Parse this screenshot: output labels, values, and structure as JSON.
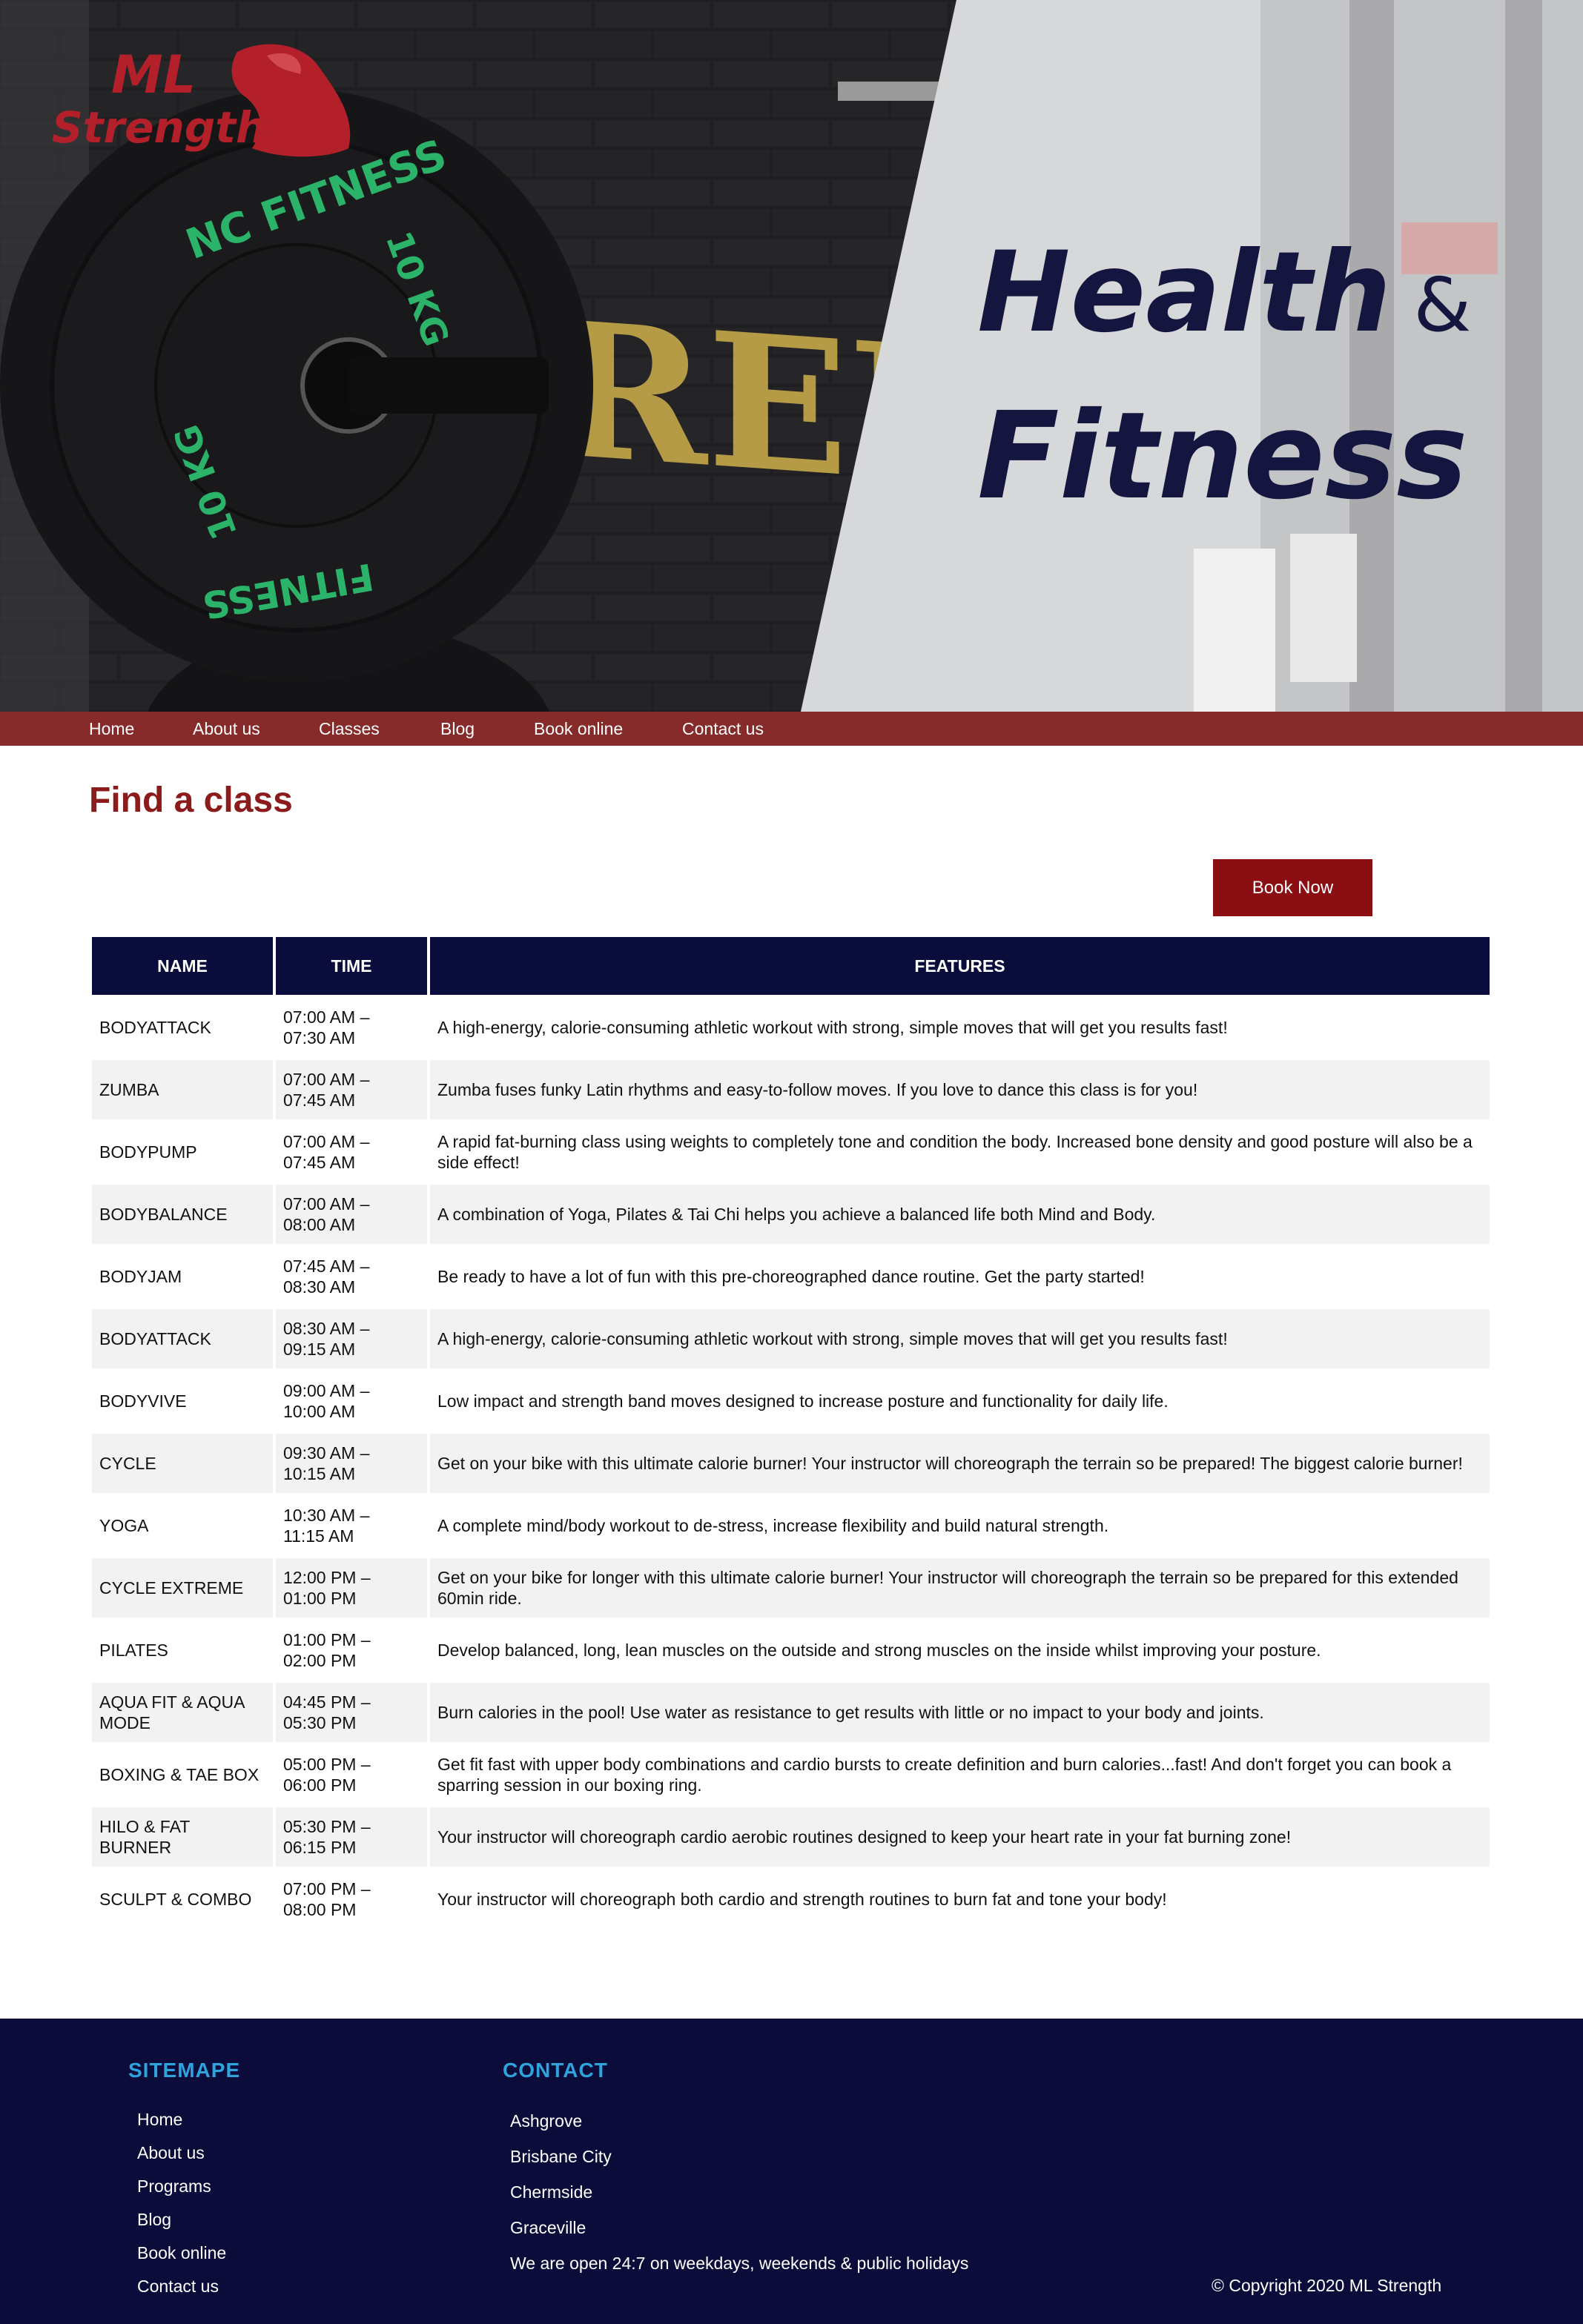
{
  "brand": {
    "logo_line1": "ML",
    "logo_line2": "Strength",
    "color_primary": "#862a2a",
    "color_dark": "#0b0c3a",
    "color_accent": "#2ea3dc"
  },
  "hero": {
    "title_word1": "Health",
    "title_amp": "&",
    "title_word2": "Fitness"
  },
  "nav": {
    "items": [
      "Home",
      "About us",
      "Classes",
      "Blog",
      "Book online",
      "Contact us"
    ]
  },
  "main": {
    "title": "Find a class",
    "book_button": "Book Now"
  },
  "table": {
    "headers": [
      "NAME",
      "TIME",
      "FEATURES"
    ],
    "rows": [
      [
        "BODYATTACK",
        "07:00 AM –\n07:30 AM",
        "A high-energy, calorie-consuming athletic workout with strong, simple moves that will get you results fast!"
      ],
      [
        "ZUMBA",
        "07:00 AM –\n07:45 AM",
        "Zumba fuses funky Latin rhythms and easy-to-follow moves. If you love to dance this class is for you!"
      ],
      [
        "BODYPUMP",
        "07:00 AM –\n07:45 AM",
        "A rapid fat-burning class using weights to completely tone and condition the body. Increased bone density and good posture will also be a side effect!"
      ],
      [
        "BODYBALANCE",
        "07:00 AM –\n08:00 AM",
        "A combination of Yoga, Pilates & Tai Chi helps you achieve a balanced life both Mind and Body."
      ],
      [
        "BODYJAM",
        "07:45 AM –\n08:30 AM",
        "Be ready to have a lot of fun with this pre-choreographed dance routine. Get the party started!"
      ],
      [
        "BODYATTACK",
        "08:30 AM –\n09:15 AM",
        "A high-energy, calorie-consuming athletic workout with strong, simple moves that will get you results fast!"
      ],
      [
        "BODYVIVE",
        "09:00 AM –\n10:00 AM",
        "Low impact and strength band moves designed to increase posture and functionality for daily life."
      ],
      [
        "CYCLE",
        "09:30 AM –\n10:15 AM",
        "Get on your bike with this ultimate calorie burner! Your instructor will choreograph the terrain so be prepared! The biggest calorie burner!"
      ],
      [
        "YOGA",
        "10:30 AM –\n11:15 AM",
        "A complete mind/body workout to de-stress, increase flexibility and build natural strength."
      ],
      [
        "CYCLE EXTREME",
        "12:00 PM –\n01:00 PM",
        "Get on your bike for longer with this ultimate calorie burner! Your instructor will choreograph the terrain so be prepared for this extended 60min ride."
      ],
      [
        "PILATES",
        "01:00 PM –\n02:00 PM",
        "Develop balanced, long, lean muscles on the outside and strong muscles on the inside whilst improving your posture."
      ],
      [
        "AQUA FIT & AQUA MODE",
        "04:45 PM –\n05:30 PM",
        "Burn calories in the pool! Use water as resistance to get results with little or no impact to your body and joints."
      ],
      [
        "BOXING & TAE BOX",
        "05:00 PM –\n06:00 PM",
        "Get fit fast with upper body combinations and cardio bursts to create definition and burn calories...fast! And don't forget you can book a sparring session in our boxing ring."
      ],
      [
        "HILO & FAT BURNER",
        "05:30 PM –\n06:15 PM",
        "Your instructor will choreograph cardio aerobic routines designed to keep your heart rate in your fat burning zone!"
      ],
      [
        "SCULPT & COMBO",
        "07:00 PM –\n08:00 PM",
        "Your instructor will choreograph both cardio and strength routines to burn fat and tone your body!"
      ]
    ]
  },
  "footer": {
    "sitemap_title": "SITEMAPE",
    "sitemap_links": [
      "Home",
      "About us",
      "Programs",
      "Blog",
      "Book online",
      "Contact us"
    ],
    "contact_title": "CONTACT",
    "contact_lines": [
      "Ashgrove",
      "Brisbane City",
      "Chermside",
      "Graceville",
      "We are open 24:7 on weekdays, weekends & public holidays"
    ],
    "copyright": "© Copyright 2020 ML Strength"
  }
}
